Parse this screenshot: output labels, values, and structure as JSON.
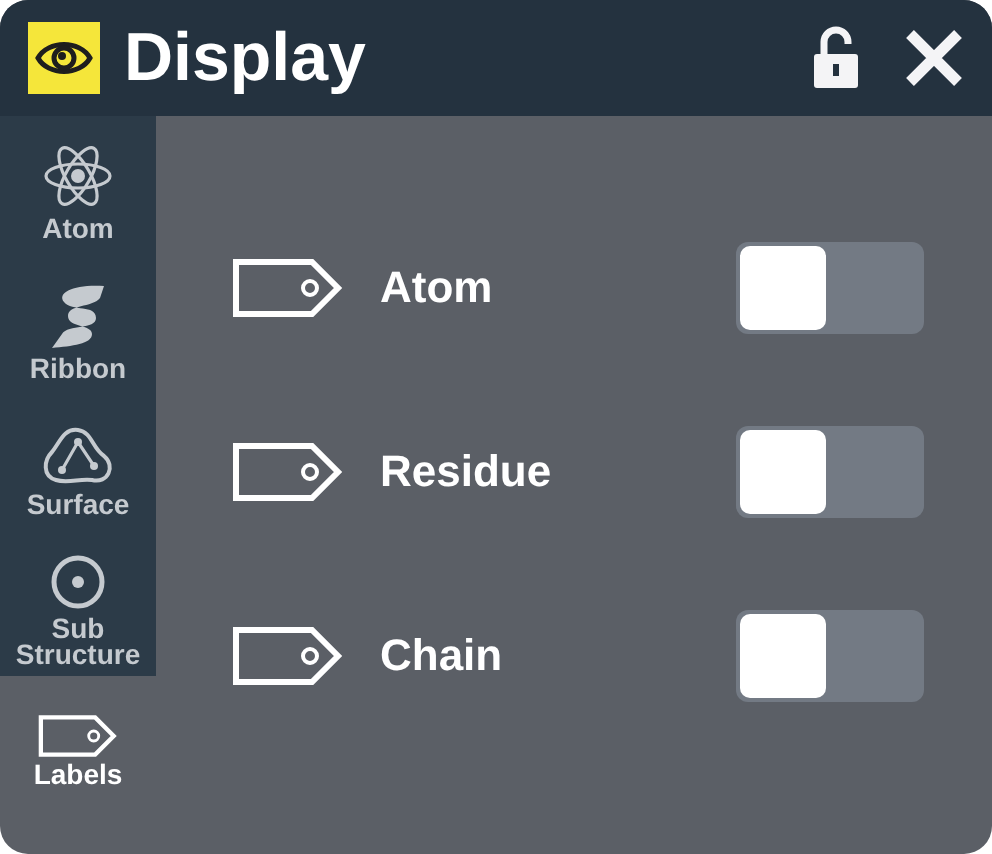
{
  "window": {
    "title": "Display"
  },
  "tabs": [
    {
      "kind": "atom",
      "label": "Atom",
      "selected": false
    },
    {
      "kind": "ribbon",
      "label": "Ribbon",
      "selected": false
    },
    {
      "kind": "surface",
      "label": "Surface",
      "selected": false
    },
    {
      "kind": "substructure",
      "label": "Sub Structure",
      "selected": false
    },
    {
      "kind": "labels",
      "label": "Labels",
      "selected": true
    }
  ],
  "options": [
    {
      "label": "Atom",
      "on": false
    },
    {
      "label": "Residue",
      "on": false
    },
    {
      "label": "Chain",
      "on": false
    }
  ]
}
